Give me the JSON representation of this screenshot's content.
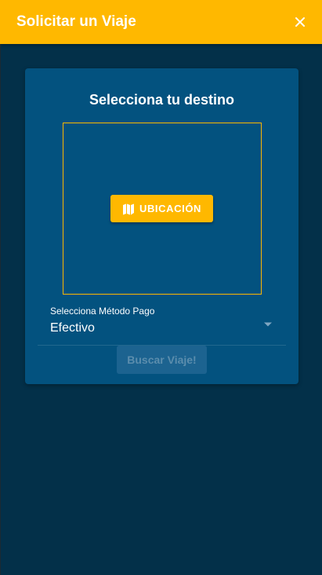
{
  "header": {
    "title": "Solicitar un Viaje",
    "close_icon": "close-icon"
  },
  "card": {
    "title": "Selecciona tu destino",
    "location_button": {
      "label": "UBICACIÓN",
      "icon": "map-icon"
    },
    "payment": {
      "label": "Selecciona Método Pago",
      "selected": "Efectivo",
      "icon": "dropdown-arrow-icon"
    },
    "search_button": {
      "label": "Buscar Viaje!",
      "disabled": true
    }
  },
  "colors": {
    "accent": "#ffb800",
    "background": "#033049",
    "card": "#03527f"
  }
}
